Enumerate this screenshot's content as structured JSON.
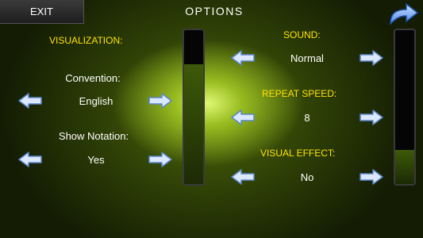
{
  "header": {
    "exit_label": "EXIT",
    "title": "OPTIONS"
  },
  "left": {
    "section_title": "VISUALIZATION:",
    "convention": {
      "label": "Convention:",
      "value": "English"
    },
    "show_notation": {
      "label": "Show Notation:",
      "value": "Yes"
    }
  },
  "right": {
    "sound": {
      "label": "SOUND:",
      "value": "Normal"
    },
    "repeat_speed": {
      "label": "REPEAT SPEED:",
      "value": "8"
    },
    "visual_effect": {
      "label": "VISUAL EFFECT:",
      "value": "No"
    }
  },
  "sliders": {
    "left_level": 0.78,
    "right_level": 0.22
  },
  "icons": {
    "arrow_left": "arrow-left-icon",
    "arrow_right": "arrow-right-icon",
    "back": "back-curved-arrow-icon"
  },
  "colors": {
    "section_heading": "#ffe200",
    "text": "#ffffff",
    "arrow": "#dbe8ff"
  }
}
